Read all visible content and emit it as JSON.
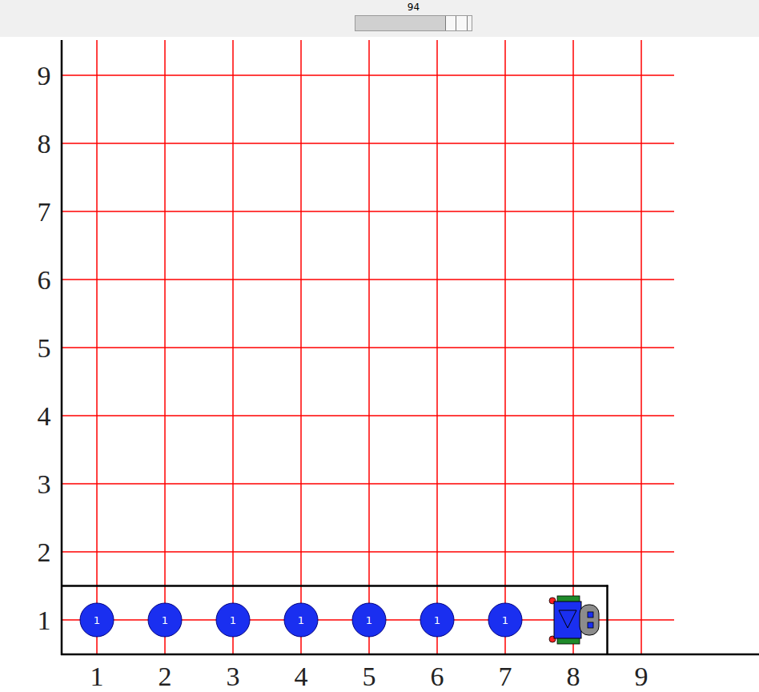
{
  "speed_slider": {
    "label": "94",
    "level": 0.94
  },
  "world": {
    "x_axis": {
      "labels": [
        "1",
        "2",
        "3",
        "4",
        "5",
        "6",
        "7",
        "8",
        "9"
      ]
    },
    "y_axis": {
      "labels": [
        "1",
        "2",
        "3",
        "4",
        "5",
        "6",
        "7",
        "8",
        "9"
      ]
    },
    "walls": [
      {
        "kind": "horizontal",
        "street": 1,
        "from_avenue": 1,
        "to_avenue": 8
      },
      {
        "kind": "vertical",
        "avenue": 8,
        "street": 1
      }
    ],
    "beepers": [
      {
        "avenue": 1,
        "street": 1,
        "count": "1"
      },
      {
        "avenue": 2,
        "street": 1,
        "count": "1"
      },
      {
        "avenue": 3,
        "street": 1,
        "count": "1"
      },
      {
        "avenue": 4,
        "street": 1,
        "count": "1"
      },
      {
        "avenue": 5,
        "street": 1,
        "count": "1"
      },
      {
        "avenue": 6,
        "street": 1,
        "count": "1"
      },
      {
        "avenue": 7,
        "street": 1,
        "count": "1"
      }
    ],
    "robot": {
      "avenue": 8,
      "street": 1,
      "direction": "east"
    }
  }
}
